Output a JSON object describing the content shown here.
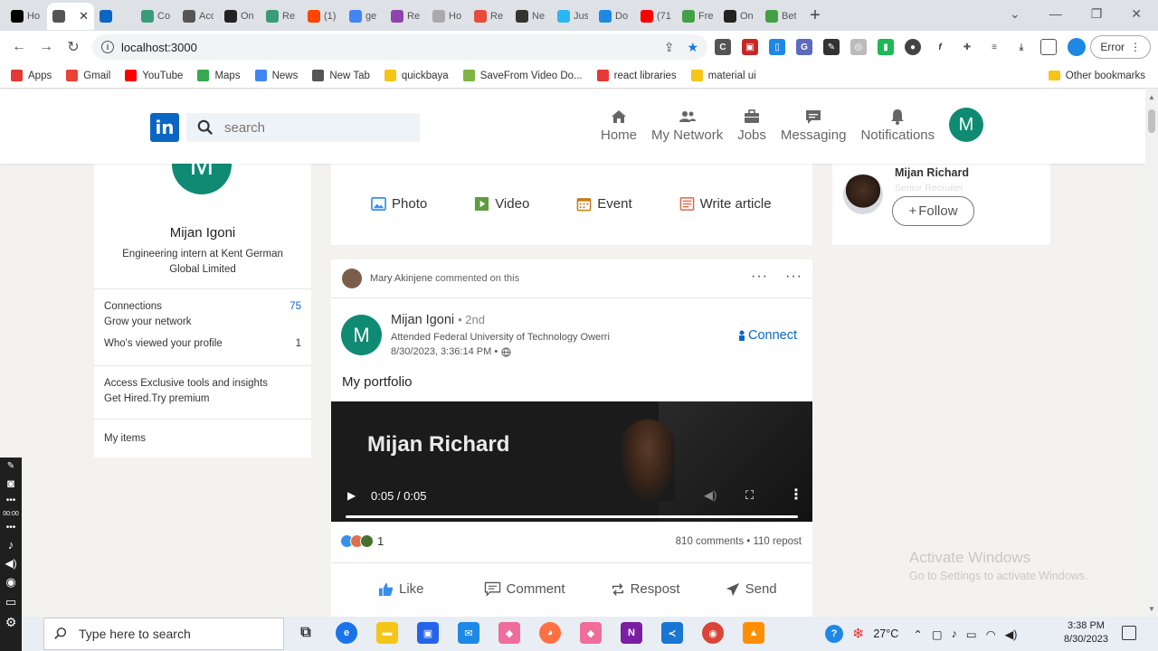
{
  "browser": {
    "tabs": [
      {
        "label": "Ho",
        "icon": "x-icon",
        "color": "#000000"
      },
      {
        "label": "",
        "icon": "globe-icon",
        "color": "#555555",
        "active": true
      },
      {
        "label": "",
        "icon": "linkedin-icon",
        "color": "#0a66c2"
      },
      {
        "label": "Co",
        "icon": "globe-icon",
        "color": "#3a9b7b"
      },
      {
        "label": "Acc",
        "icon": "globe-icon",
        "color": "#555555"
      },
      {
        "label": "On",
        "icon": "globe-icon",
        "color": "#222222"
      },
      {
        "label": "Re",
        "icon": "globe-icon",
        "color": "#3a9b7b"
      },
      {
        "label": "(1)",
        "icon": "reddit-icon",
        "color": "#ff4500"
      },
      {
        "label": "ge",
        "icon": "google-icon",
        "color": "#4285f4"
      },
      {
        "label": "Re",
        "icon": "globe-icon",
        "color": "#8e44ad"
      },
      {
        "label": "Ho",
        "icon": "globe-icon",
        "color": "#aaaaaa"
      },
      {
        "label": "Re",
        "icon": "react-icon",
        "color": "#e74c3c"
      },
      {
        "label": "Ne",
        "icon": "globe-icon",
        "color": "#333333"
      },
      {
        "label": "Jus",
        "icon": "globe-icon",
        "color": "#29b6f6"
      },
      {
        "label": "Do",
        "icon": "download-icon",
        "color": "#1e88e5"
      },
      {
        "label": "(71",
        "icon": "youtube-icon",
        "color": "#ff0000"
      },
      {
        "label": "Fre",
        "icon": "globe-icon",
        "color": "#43a047"
      },
      {
        "label": "On",
        "icon": "globe-icon",
        "color": "#222222"
      },
      {
        "label": "Bet",
        "icon": "globe-icon",
        "color": "#43a047"
      }
    ],
    "url": "localhost:3000",
    "error_label": "Error",
    "bookmarks": [
      {
        "label": "Apps",
        "icon": "apps-icon",
        "color": "#e53935"
      },
      {
        "label": "Gmail",
        "icon": "gmail-icon",
        "color": "#ea4335"
      },
      {
        "label": "YouTube",
        "icon": "youtube-icon",
        "color": "#ff0000"
      },
      {
        "label": "Maps",
        "icon": "maps-icon",
        "color": "#34a853"
      },
      {
        "label": "News",
        "icon": "news-icon",
        "color": "#4285f4"
      },
      {
        "label": "New Tab",
        "icon": "globe-icon",
        "color": "#555555"
      },
      {
        "label": "quickbaya",
        "icon": "folder-icon",
        "color": "#f5c518"
      },
      {
        "label": "SaveFrom Video Do...",
        "icon": "savefrom-icon",
        "color": "#7cb342"
      },
      {
        "label": "react libraries",
        "icon": "react-icon",
        "color": "#e53935"
      },
      {
        "label": "material ui",
        "icon": "folder-icon",
        "color": "#f5c518"
      }
    ],
    "other_bookmarks": "Other bookmarks"
  },
  "linkedin": {
    "logo": "in",
    "search_placeholder": "search",
    "nav": [
      {
        "label": "Home",
        "icon": "home-icon"
      },
      {
        "label": "My Network",
        "icon": "network-icon"
      },
      {
        "label": "Jobs",
        "icon": "briefcase-icon"
      },
      {
        "label": "Messaging",
        "icon": "message-icon"
      },
      {
        "label": "Notifications",
        "icon": "bell-icon"
      }
    ],
    "me_initial": "M",
    "brand_color": "#0a66c2",
    "avatar_color": "#0f8b73"
  },
  "profile": {
    "initial": "M",
    "name": "Mijan Igoni",
    "headline": "Engineering intern at Kent German Global Limited",
    "connections_label": "Connections",
    "connections_value": "75",
    "grow_label": "Grow your network",
    "viewed_label": "Who's viewed your profile",
    "viewed_value": "1",
    "premium_line1": "Access Exclusive tools and insights",
    "premium_line2": "Get Hired.Try premium",
    "my_items": "My items"
  },
  "share": {
    "photo": "Photo",
    "video": "Video",
    "event": "Event",
    "article": "Write article"
  },
  "post": {
    "commenter": "Mary Akinjene",
    "commented_suffix": "commented on this",
    "author_initial": "M",
    "author_name": "Mijan Igoni",
    "author_degree": "• 2nd",
    "author_sub": "Attended Federal University of Technology Owerri",
    "timestamp": "8/30/2023, 3:36:14 PM •",
    "connect_label": "Connect",
    "text": "My portfolio",
    "video_title": "Mijan Richard",
    "video_time": "0:05 / 0:05",
    "reaction_count": "1",
    "comment_stats": "810 comments • 110 repost",
    "actions": {
      "like": "Like",
      "comment": "Comment",
      "repost": "Respost",
      "send": "Send"
    }
  },
  "suggestion": {
    "name": "Mijan Richard",
    "title": "Senior Recruiter",
    "follow_label": "Follow"
  },
  "watermark": {
    "line1": "Activate Windows",
    "line2": "Go to Settings to activate Windows."
  },
  "taskbar": {
    "search_placeholder": "Type here to search",
    "temperature": "27°C",
    "time": "3:38 PM",
    "date": "8/30/2023"
  },
  "recorder": {
    "timer": "00:00"
  }
}
